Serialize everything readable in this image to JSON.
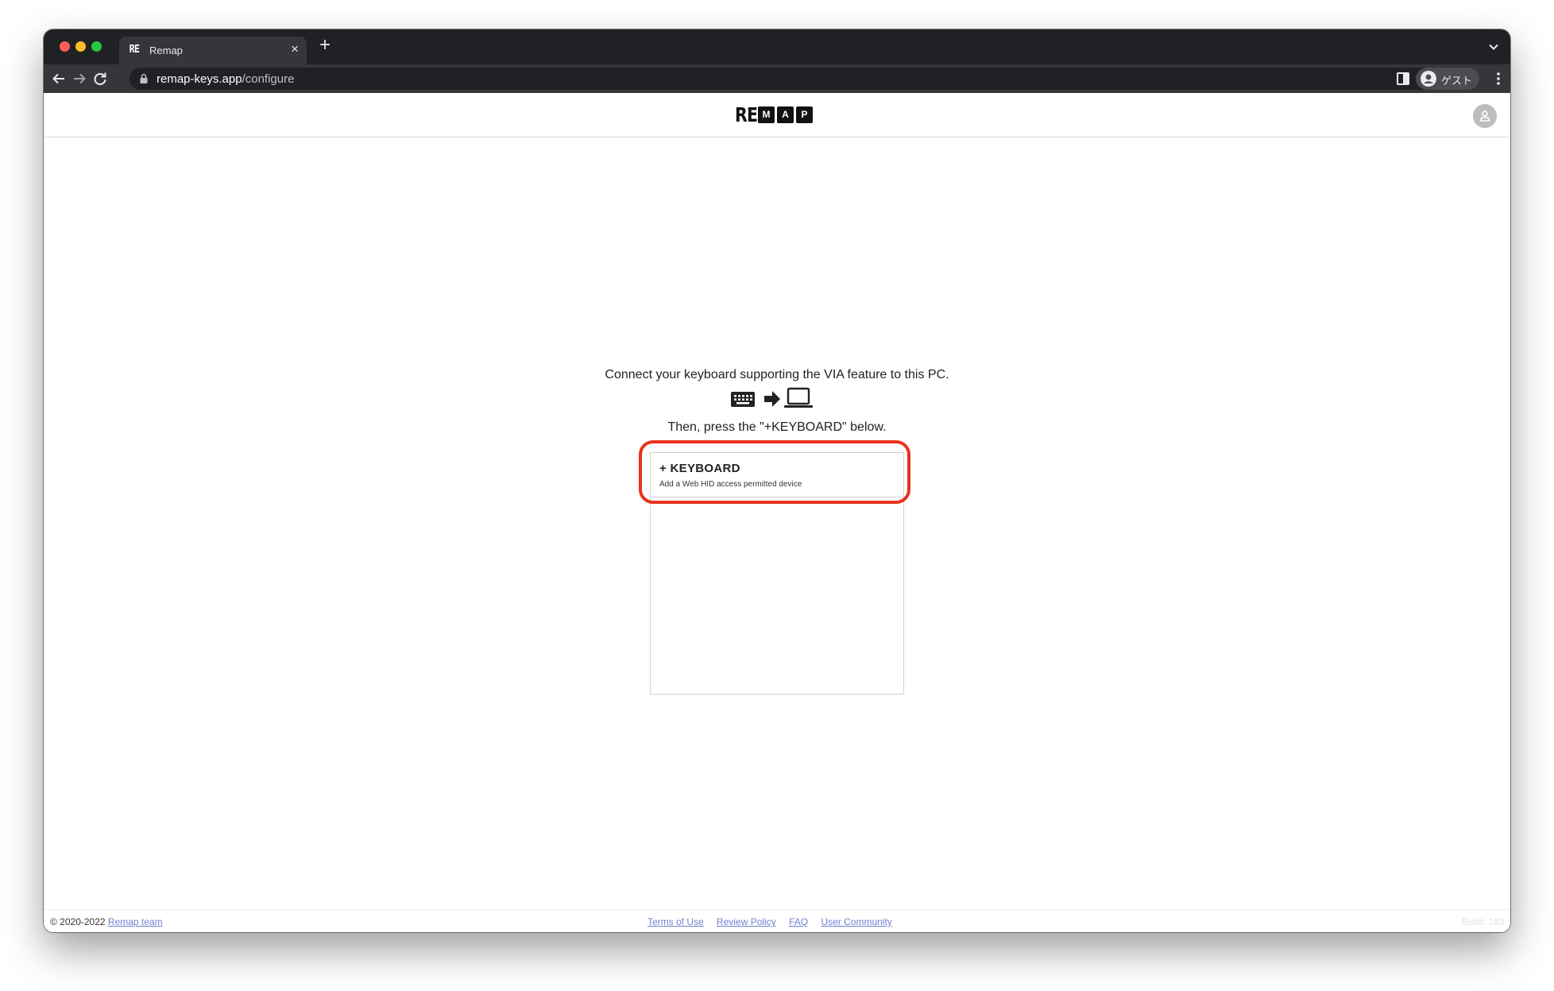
{
  "browser": {
    "tab": {
      "favicon_text": "RE",
      "title": "Remap",
      "close_glyph": "×"
    },
    "new_tab_glyph": "+",
    "address": {
      "host": "remap-keys.app",
      "path": "/configure"
    },
    "profile_label": "ゲスト",
    "icons": [
      "back-arrow-icon",
      "forward-arrow-icon",
      "reload-icon",
      "lock-icon",
      "translate-icon",
      "side-panel-icon",
      "profile-icon",
      "kebab-menu-icon",
      "tab-search-chevron-icon"
    ]
  },
  "app": {
    "logo": {
      "prefix": "RE",
      "boxes": [
        "M",
        "A",
        "P"
      ]
    },
    "instruction_1": "Connect your keyboard supporting the VIA feature to this PC.",
    "instruction_2": "Then, press the \"+KEYBOARD\" below.",
    "diagram_icons": [
      "keyboard-icon",
      "arrow-right-icon",
      "laptop-icon"
    ],
    "add_keyboard": {
      "title": "+ KEYBOARD",
      "subtitle": "Add a Web HID access permitted device"
    },
    "highlight_color": "#e8321c"
  },
  "footer": {
    "copyright": "© 2020-2022",
    "team_link": "Remap team",
    "links": [
      "Terms of Use",
      "Review Policy",
      "FAQ",
      "User Community"
    ],
    "build": "Build: 183"
  }
}
